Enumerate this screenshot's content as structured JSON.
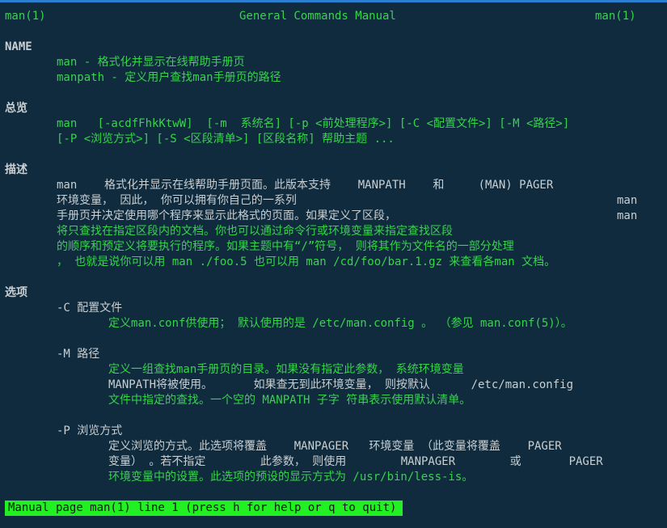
{
  "header": {
    "left": "man(1)",
    "center": "General Commands Manual",
    "right": "man(1)"
  },
  "name": {
    "heading": "NAME",
    "line1": "man - 格式化并显示在线帮助手册页",
    "line2": "manpath - 定义用户查找man手册页的路径"
  },
  "synopsis": {
    "heading": "总览",
    "line1": "man   [-acdfFhkKtwW]  [-m  系统名] [-p <前处理程序>] [-C <配置文件>] [-M <路径>]",
    "line2": "[-P <浏览方式>] [-S <区段清单>] [区段名称] 帮助主题 ..."
  },
  "description": {
    "heading": "描述",
    "l1a": "man    格式化并显示在线帮助手册页面。此版本支持    MANPATH    和     (MAN) PAGER",
    "l2a": "环境变量， 因此， 你可以拥有你自己的一系列",
    "l2b": "man",
    "l3a": "手册页并决定使用哪个程序来显示此格式的页面。如果定义了区段，",
    "l3b": "man",
    "l4": "将只查找在指定区段内的文档。你也可以通过命令行或环境变量来指定查找区段",
    "l5": "的顺序和预定义将要执行的程序。如果主题中有“/”符号， 则将其作为文件名的一部分处理",
    "l6": "， 也就是说你可以用 man ./foo.5 也可以用 man /cd/foo/bar.1.gz 来查看各man 文档。"
  },
  "options": {
    "heading": "选项",
    "c": {
      "flag": "-C 配置文件",
      "l1": "定义man.conf供使用； 默认使用的是 /etc/man.config 。 （参见 man.conf(5)）。"
    },
    "m": {
      "flag": "-M 路径",
      "l1": "定义一组查找man手册页的目录。如果没有指定此参数， 系统环境变量",
      "l2": "MANPATH将被使用。      如果查无到此环境变量， 则按默认      /etc/man.config",
      "l3": "文件中指定的查找。一个空的 MANPATH 子字 符串表示使用默认清单。"
    },
    "p": {
      "flag": "-P 浏览方式",
      "l1": "定义浏览的方式。此选项将覆盖    MANPAGER   环境变量 （此变量将覆盖    PAGER",
      "l2": "变量） 。若不指定        此参数， 则使用        MANPAGER        或       PAGER",
      "l3": "环境变量中的设置。此选项的预设的显示方式为 /usr/bin/less-is。"
    }
  },
  "status": {
    "text": "Manual page man(1) line 1 (press h for help or q to quit)"
  },
  "colors": {
    "background": "#0f2b3d",
    "text_green": "#37d44c",
    "text_white": "#c9cfd2",
    "status_bg": "#22f022"
  }
}
